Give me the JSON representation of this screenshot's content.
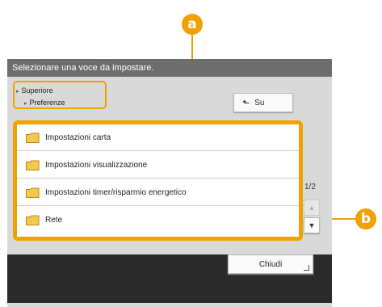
{
  "callouts": {
    "a": "a",
    "b": "b"
  },
  "title_bar": {
    "text": "Selezionare una voce da impostare."
  },
  "breadcrumb": {
    "level1": "Superiore",
    "level2": "Preferenze"
  },
  "up_button": {
    "icon": "up-arrow-icon",
    "label": "Su"
  },
  "list": {
    "items": [
      {
        "label": "Impostazioni carta",
        "icon": "folder-icon"
      },
      {
        "label": "Impostazioni visualizzazione",
        "icon": "folder-icon"
      },
      {
        "label": "Impostazioni timer/risparmio energetico",
        "icon": "folder-icon"
      },
      {
        "label": "Rete",
        "icon": "folder-icon"
      }
    ]
  },
  "pager": {
    "text": "1/2"
  },
  "scroll": {
    "up_icon": "triangle-up-icon",
    "down_icon": "triangle-down-icon"
  },
  "close_button": {
    "label": "Chiudi"
  },
  "colors": {
    "callout": "#f0a000",
    "title_bar": "#6d6d6d",
    "panel": "#d9d9d9",
    "bottom_bar": "#2a2a2a"
  }
}
